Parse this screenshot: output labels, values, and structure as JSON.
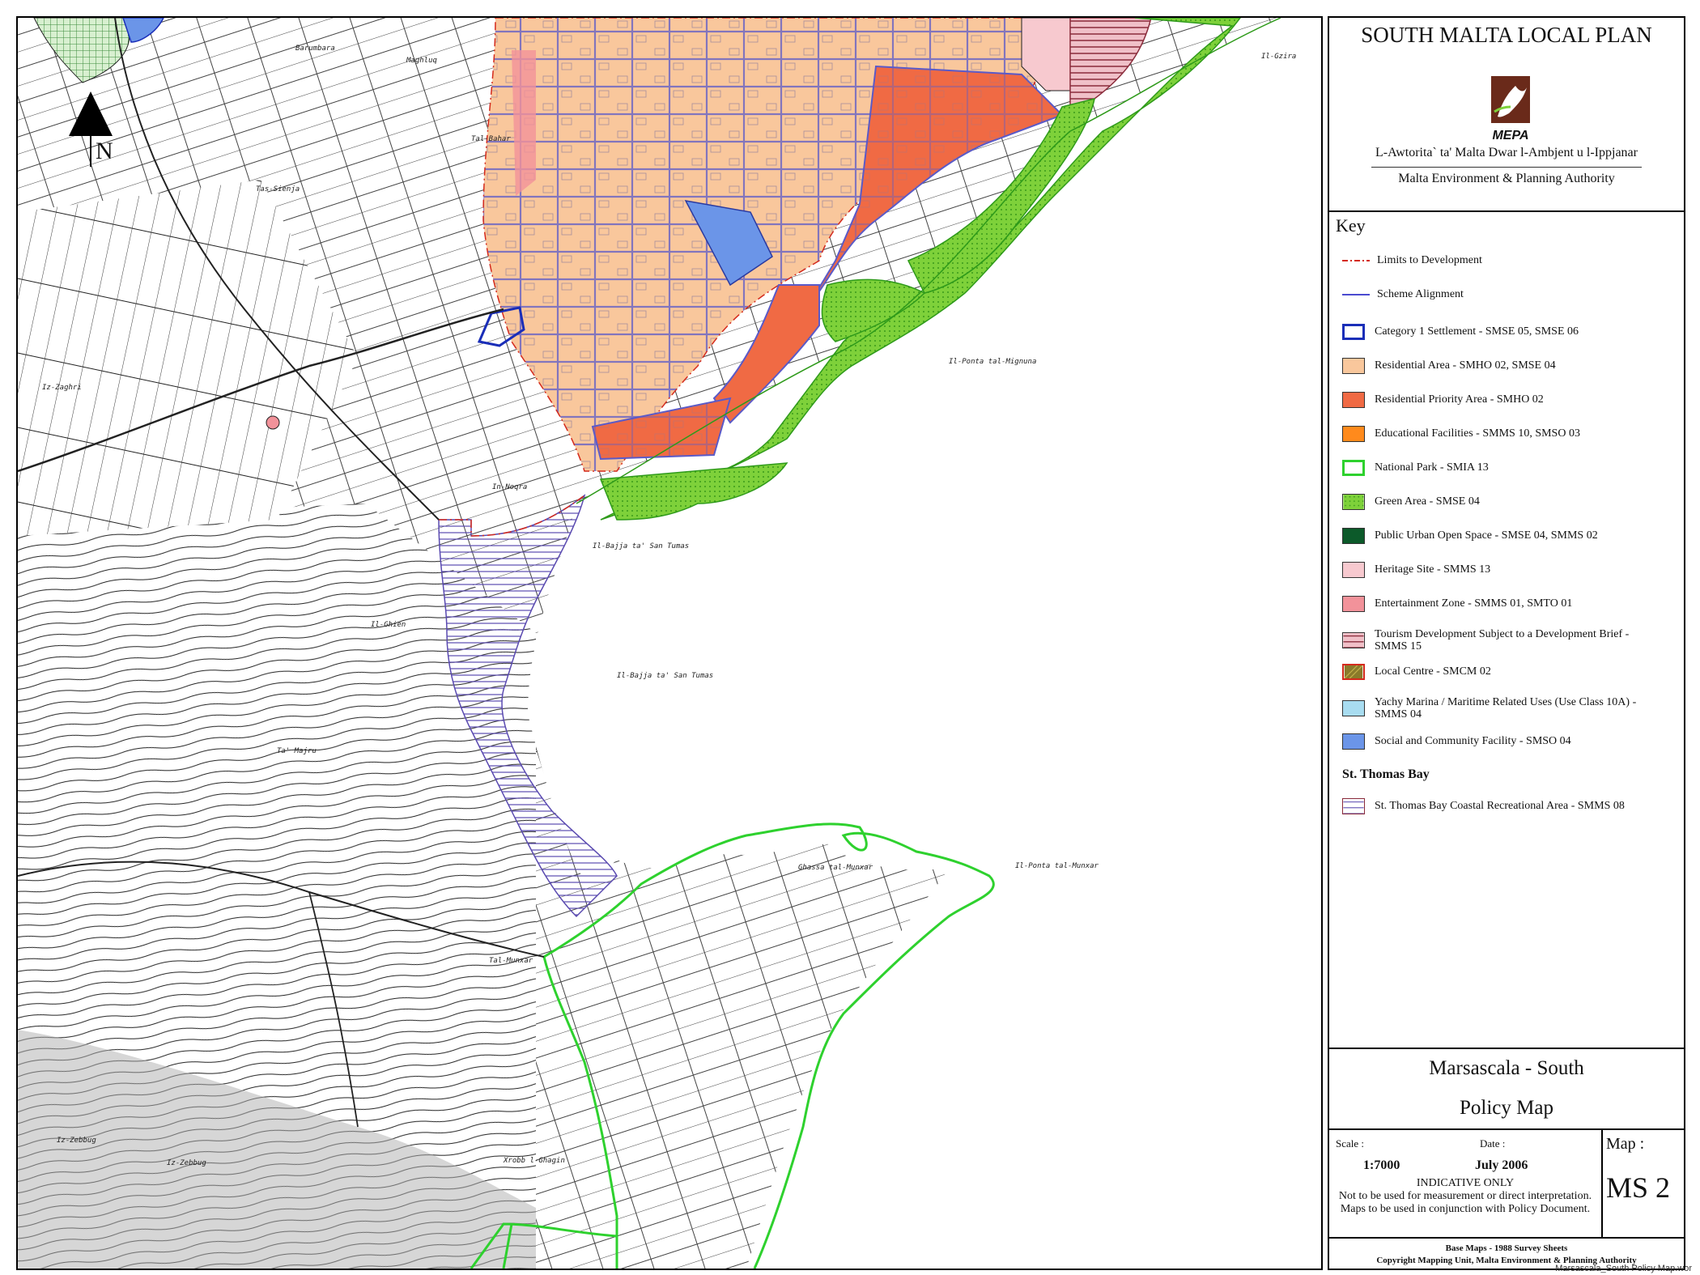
{
  "title": "SOUTH MALTA LOCAL PLAN",
  "logo_text": "MEPA",
  "authority_maltese": "L-Awtorita` ta' Malta Dwar l-Ambjent u l-Ippjanar",
  "authority_english": "Malta Environment & Planning Authority",
  "key_title": "Key",
  "legend": [
    {
      "label": "Limits to Development",
      "symbol": "dash-dot-line",
      "color": "#d42a1c"
    },
    {
      "label": "Scheme Alignment",
      "symbol": "line",
      "color": "#4a4ad0"
    },
    {
      "label": "Category 1 Settlement - SMSE 05, SMSE 06",
      "symbol": "outline",
      "color": "#1a2eb8"
    },
    {
      "label": "Residential Area - SMHO 02, SMSE 04",
      "symbol": "fill",
      "color": "#f9c79c"
    },
    {
      "label": "Residential Priority Area - SMHO 02",
      "symbol": "fill",
      "color": "#f06a44"
    },
    {
      "label": "Educational Facilities - SMMS 10, SMSO 03",
      "symbol": "fill",
      "color": "#ff8a1c"
    },
    {
      "label": "National Park - SMIA 13",
      "symbol": "outline",
      "color": "#2ed12e"
    },
    {
      "label": "Green Area - SMSE 04",
      "symbol": "fill-dotted",
      "color": "#7ed13a"
    },
    {
      "label": "Public Urban Open Space - SMSE 04, SMMS 02",
      "symbol": "fill",
      "color": "#0c5a2a"
    },
    {
      "label": "Heritage Site - SMMS 13",
      "symbol": "fill",
      "color": "#f7c9cf"
    },
    {
      "label": "Entertainment Zone - SMMS 01, SMTO 01",
      "symbol": "fill",
      "color": "#f2929a"
    },
    {
      "label": "Tourism Development Subject to a Development Brief - SMMS 15",
      "symbol": "hatch",
      "color": "#8a2a3a"
    },
    {
      "label": "Local Centre - SMCM 02",
      "symbol": "fill-dotted",
      "color": "#8a7a2a"
    },
    {
      "label": "Yachy Marina / Maritime Related Uses (Use Class 10A) - SMMS 04",
      "symbol": "fill",
      "color": "#a8dcf0"
    },
    {
      "label": "Social and Community Facility - SMSO 04",
      "symbol": "fill",
      "color": "#6b95e8"
    }
  ],
  "st_thomas_heading": "St. Thomas Bay",
  "st_thomas_item": {
    "label": "St. Thomas Bay Coastal Recreational Area - SMMS 08",
    "symbol": "hatch",
    "color": "#4a3a9a"
  },
  "map_subtitle_1": "Marsascala - South",
  "map_subtitle_2": "Policy Map",
  "scale_label": "Scale :",
  "scale_value": "1:7000",
  "date_label": "Date :",
  "date_value": "July 2006",
  "map_label": "Map :",
  "map_number": "MS 2",
  "indicative_1": "INDICATIVE ONLY",
  "indicative_2": "Not to be used for measurement or direct interpretation.",
  "indicative_3": "Maps to be used in conjunction with Policy Document.",
  "base_maps_1": "Base Maps - 1988 Survey Sheets",
  "base_maps_2": "Copyright Mapping Unit, Malta Environment & Planning Authority",
  "file_name": "Marsascala_South Policy Map.wor",
  "north_label": "N",
  "place_names": {
    "barumbara": "Barumbara",
    "maghluq": "Maghluq",
    "tal_bahar": "Tal-Bahar",
    "tas_sienja": "Tas-Sienja",
    "iz_zaghri": "Iz-Zaghri",
    "il_gzira": "Il-Gzira",
    "il_ponta_mignuna": "Il-Ponta tal-Mignuna",
    "in_noqra": "In-Noqra",
    "il_bajja_1": "Il-Bajja ta' San Tumas",
    "il_bajja_2": "Il-Bajja ta' San Tumas",
    "il_ghien": "Il-Ghien",
    "ta_majru": "Ta' Majru",
    "ghassa": "Ghassa tal-Munxar",
    "il_ponta_munxar": "Il-Ponta tal-Munxar",
    "tal_munxar": "Tal-Munxar",
    "xrobb": "Xrobb l-Ghagin",
    "iz_zebbug_1": "Iz-Zebbug",
    "iz_zebbug_2": "Iz-Zebbug"
  }
}
